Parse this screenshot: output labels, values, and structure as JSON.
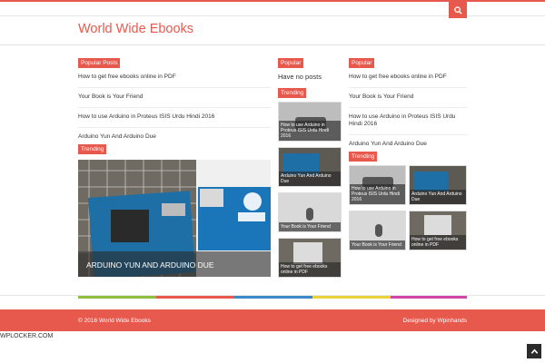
{
  "site": {
    "title": "World Wide Ebooks"
  },
  "colors": {
    "accent": "#e8594d",
    "stripes": [
      "#8cbf3f",
      "#e8594d",
      "#3b89c9",
      "#e8d43a",
      "#d444a6"
    ]
  },
  "header": {
    "search_icon": "search-icon"
  },
  "left": {
    "popular_tag": "Popular Posts",
    "posts": [
      "How to get free ebooks online in PDF",
      "Your Book is Your Friend",
      "How to use Arduino in Proteus ISIS Urdu Hindi 2016",
      "Arduino Yun And Arduino Due"
    ],
    "trending_tag": "Trending",
    "featured_caption": "ARDUINO YUN AND ARDUINO DUE"
  },
  "middle": {
    "popular_tag": "Popular",
    "no_posts": "Have no posts",
    "trending_tag": "Trending",
    "thumbs": [
      "How to use Arduino in Proteus ISIS Urdu Hindi 2016",
      "Arduino Yun And Arduino Due",
      "Your Book is Your Friend",
      "How to get free ebooks online in PDF"
    ]
  },
  "right": {
    "popular_tag": "Popular",
    "posts": [
      "How to get free ebooks online in PDF",
      "Your Book is Your Friend",
      "How to use Arduino in Proteus ISIS Urdu Hindi 2016",
      "Arduino Yun And Arduino Due"
    ],
    "trending_tag": "Trending",
    "thumbs": [
      "How to use Arduino in Proteus ISIS Urdu Hindi 2016",
      "Arduino Yun And Arduino Due",
      "Your Book is Your Friend",
      "How to get free ebooks online in PDF"
    ]
  },
  "footer": {
    "copyright": "© 2016 World Wide Ebooks",
    "credit": "Designed by Wpinhands"
  },
  "watermark": "WPLOCKER.COM",
  "back_to_top_icon": "chevron-up-icon"
}
